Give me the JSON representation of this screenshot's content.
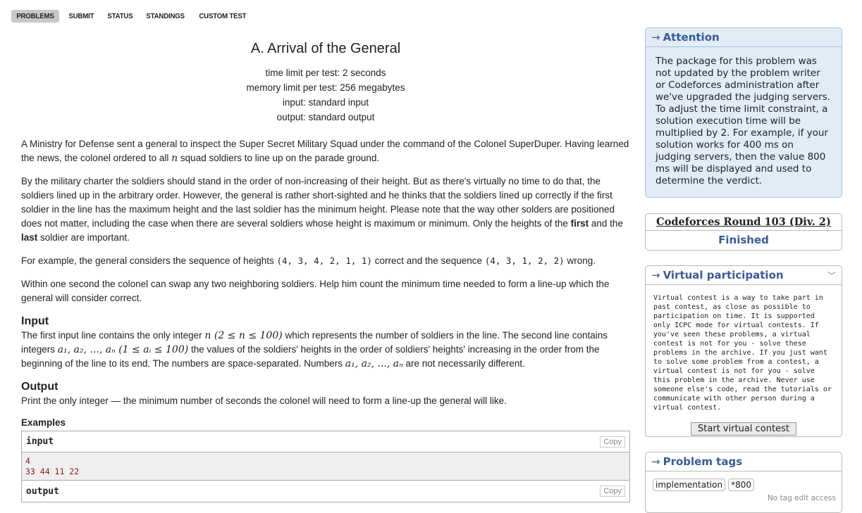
{
  "nav": {
    "items": [
      "PROBLEMS",
      "SUBMIT",
      "STATUS",
      "STANDINGS",
      "CUSTOM TEST"
    ]
  },
  "problem": {
    "title": "A. Arrival of the General",
    "time_limit": "time limit per test: 2 seconds",
    "memory_limit": "memory limit per test: 256 megabytes",
    "input_spec": "input: standard input",
    "output_spec": "output: standard output",
    "p1a": "A Ministry for Defense sent a general to inspect the Super Secret Military Squad under the command of the Colonel SuperDuper. Having learned the news, the colonel ordered to all ",
    "p1_var": "n",
    "p1b": " squad soldiers to line up on the parade ground.",
    "p2a": "By the military charter the soldiers should stand in the order of non-increasing of their height. But as there's virtually no time to do that, the soldiers lined up in the arbitrary order. However, the general is rather short-sighted and he thinks that the soldiers lined up correctly if the first soldier in the line has the maximum height and the last soldier has the minimum height. Please note that the way other solders are positioned does not matter, including the case when there are several soldiers whose height is maximum or minimum. Only the heights of the ",
    "p2_first": "first",
    "p2_and": " and the ",
    "p2_last": "last",
    "p2b": " soldier are important.",
    "p3a": "For example, the general considers the sequence of heights ",
    "p3_seq1": "(4, 3, 4, 2, 1, 1)",
    "p3b": " correct and the sequence ",
    "p3_seq2": "(4, 3, 1, 2, 2)",
    "p3c": " wrong.",
    "p4": "Within one second the colonel can swap any two neighboring soldiers. Help him count the minimum time needed to form a line-up which the general will consider correct.",
    "input_title": "Input",
    "input_a": "The first input line contains the only integer ",
    "input_math1": "n (2 ≤ n ≤ 100)",
    "input_b": " which represents the number of soldiers in the line. The second line contains integers ",
    "input_math2": "a₁, a₂, ..., aₙ (1 ≤ aᵢ ≤ 100)",
    "input_c": " the values of the soldiers' heights in the order of soldiers' heights' increasing in the order from the beginning of the line to its end. The numbers are space-separated. Numbers ",
    "input_math3": "a₁, a₂, ..., aₙ",
    "input_d": " are not necessarily different.",
    "output_title": "Output",
    "output_text": "Print the only integer — the minimum number of seconds the colonel will need to form a line-up the general will like.",
    "examples_title": "Examples",
    "sample_input_label": "input",
    "sample_input_lines": [
      "4",
      "33 44 11 22"
    ],
    "sample_output_label": "output",
    "copy_label": "Copy"
  },
  "sidebar": {
    "attention": {
      "title": "Attention",
      "text": "The package for this problem was not updated by the problem writer or Codeforces administration after we've upgraded the judging servers. To adjust the time limit constraint, a solution execution time will be multiplied by 2. For example, if your solution works for 400 ms on judging servers, then the value 800 ms will be displayed and used to determine the verdict."
    },
    "round": {
      "name": "Codeforces Round 103 (Div. 2)",
      "status": "Finished"
    },
    "virtual": {
      "title": "Virtual participation",
      "text": "Virtual contest is a way to take part in past contest, as close as possible to participation on time. It is supported only ICPC mode for virtual contests. If you've seen these problems, a virtual contest is not for you - solve these problems in the archive. If you just want to solve some problem from a contest, a virtual contest is not for you - solve this problem in the archive. Never use someone else's code, read the tutorials or communicate with other person during a virtual contest.",
      "button": "Start virtual contest"
    },
    "tags": {
      "title": "Problem tags",
      "items": [
        "implementation",
        "*800"
      ],
      "note": "No tag edit access"
    }
  },
  "colors": {
    "link_blue": "#3b5998",
    "attention_bg": "#e1ecf7",
    "sample_text": "#8b1a1a"
  }
}
